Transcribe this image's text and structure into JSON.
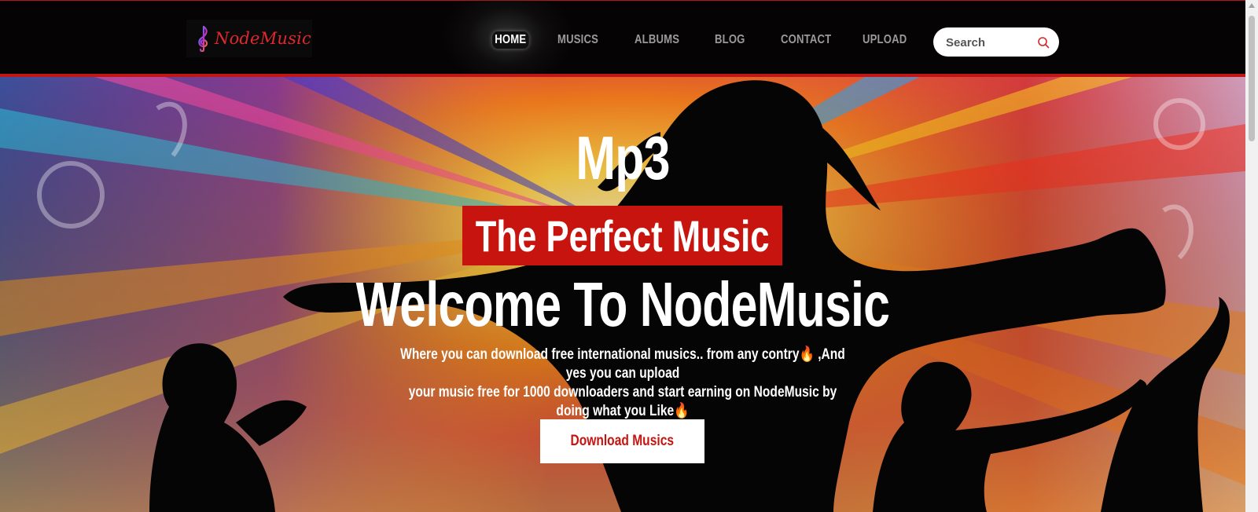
{
  "brand": {
    "name": "NodeMusic",
    "logo_icon": "treble-clef-icon"
  },
  "nav": {
    "items": [
      {
        "label": "HOME",
        "active": true
      },
      {
        "label": "MUSICS",
        "active": false
      },
      {
        "label": "ALBUMS",
        "active": false
      },
      {
        "label": "BLOG",
        "active": false
      },
      {
        "label": "CONTACT",
        "active": false
      },
      {
        "label": "UPLOAD",
        "active": false
      }
    ]
  },
  "search": {
    "placeholder": "Search",
    "value": "",
    "icon": "search-icon"
  },
  "hero": {
    "eyebrow": "Mp3",
    "tagline": "The Perfect Music",
    "title": "Welcome To NodeMusic",
    "description": "Where you can download free international musics.. from any contry🔥 ,And yes you can upload\nyour music free for 1000 downloaders and start earning on NodeMusic by doing what you Like🔥",
    "cta_label": "Download Musics"
  },
  "colors": {
    "accent": "#c8140f",
    "header_bg": "#050303",
    "nav_text": "#9a9a9a"
  }
}
